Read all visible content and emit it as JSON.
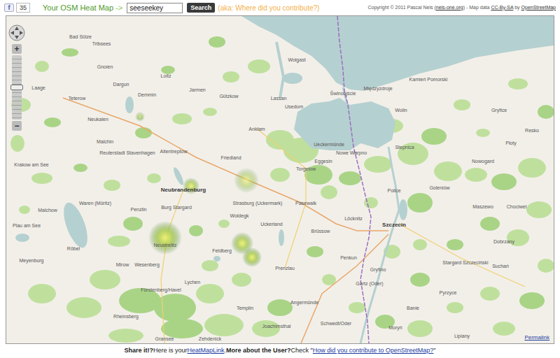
{
  "toolbar": {
    "share": {
      "icon": "f",
      "count": "35"
    },
    "title": "Your OSM Heat Map",
    "arrow": " ->",
    "search": {
      "value": "seeseekey",
      "button": "Search"
    },
    "aka": "(aka: Where did you contribute?)",
    "copyright": [
      {
        "text": "Copyright © 2011 Pascal Neis (",
        "kind": "plain"
      },
      {
        "text": "neis-one.org",
        "kind": "link"
      },
      {
        "text": ") - Map data ",
        "kind": "plain"
      },
      {
        "text": "CC-By-SA",
        "kind": "link"
      },
      {
        "text": " by ",
        "kind": "plain"
      },
      {
        "text": "OpenStreetMap",
        "kind": "link"
      }
    ]
  },
  "map": {
    "zoom": {
      "in": "+",
      "out": "−",
      "level": 0.5
    },
    "places": [
      {
        "name": "Ueckermünde",
        "kind": "town"
      },
      {
        "name": "Świnoujście",
        "kind": "town"
      },
      {
        "name": "Międzyzdroje",
        "kind": "town"
      },
      {
        "name": "Wolin",
        "kind": "town"
      },
      {
        "name": "Kamień Pomorski",
        "kind": "town"
      },
      {
        "name": "Gryfice",
        "kind": "town"
      },
      {
        "name": "Płoty",
        "kind": "town"
      },
      {
        "name": "Resko",
        "kind": "town"
      },
      {
        "name": "Nowogard",
        "kind": "town"
      },
      {
        "name": "Goleniów",
        "kind": "town"
      },
      {
        "name": "Stepnica",
        "kind": "town"
      },
      {
        "name": "Nowe Warpno",
        "kind": "town"
      },
      {
        "name": "Police",
        "kind": "town"
      },
      {
        "name": "Szczecin",
        "kind": "city"
      },
      {
        "name": "Stargard Szczeciński",
        "kind": "town"
      },
      {
        "name": "Gryfino",
        "kind": "town"
      },
      {
        "name": "Pyrzyce",
        "kind": "town"
      },
      {
        "name": "Lipiany",
        "kind": "town"
      },
      {
        "name": "Dobrzany",
        "kind": "town"
      },
      {
        "name": "Maszewo",
        "kind": "town"
      },
      {
        "name": "Chociwel",
        "kind": "town"
      },
      {
        "name": "Suchań",
        "kind": "town"
      },
      {
        "name": "Banie",
        "kind": "town"
      },
      {
        "name": "Moryń",
        "kind": "town"
      },
      {
        "name": "Schwedt/Oder",
        "kind": "town"
      },
      {
        "name": "Gartz (Oder)",
        "kind": "town"
      },
      {
        "name": "Penkun",
        "kind": "town"
      },
      {
        "name": "Löcknitz",
        "kind": "town"
      },
      {
        "name": "Brüssow",
        "kind": "town"
      },
      {
        "name": "Pasewalk",
        "kind": "town"
      },
      {
        "name": "Torgelow",
        "kind": "town"
      },
      {
        "name": "Eggesin",
        "kind": "town"
      },
      {
        "name": "Strasburg (Uckermark)",
        "kind": "town"
      },
      {
        "name": "Woldegk",
        "kind": "town"
      },
      {
        "name": "Uckerland",
        "kind": "town"
      },
      {
        "name": "Prenzlau",
        "kind": "town"
      },
      {
        "name": "Friedland",
        "kind": "town"
      },
      {
        "name": "Anklam",
        "kind": "town"
      },
      {
        "name": "Usedom",
        "kind": "town"
      },
      {
        "name": "Lassan",
        "kind": "town"
      },
      {
        "name": "Wolgast",
        "kind": "town"
      },
      {
        "name": "Gützkow",
        "kind": "town"
      },
      {
        "name": "Loitz",
        "kind": "town"
      },
      {
        "name": "Jarmen",
        "kind": "town"
      },
      {
        "name": "Demmin",
        "kind": "town"
      },
      {
        "name": "Dargun",
        "kind": "town"
      },
      {
        "name": "Neukalen",
        "kind": "town"
      },
      {
        "name": "Malchin",
        "kind": "town"
      },
      {
        "name": "Altentreptow",
        "kind": "town"
      },
      {
        "name": "Reuterstadt Stavenhagen",
        "kind": "town"
      },
      {
        "name": "Neubrandenburg",
        "kind": "city"
      },
      {
        "name": "Burg Stargard",
        "kind": "town"
      },
      {
        "name": "Penzlin",
        "kind": "town"
      },
      {
        "name": "Neustrelitz",
        "kind": "town"
      },
      {
        "name": "Feldberg",
        "kind": "town"
      },
      {
        "name": "Mirow",
        "kind": "town"
      },
      {
        "name": "Wesenberg",
        "kind": "town"
      },
      {
        "name": "Waren (Müritz)",
        "kind": "town"
      },
      {
        "name": "Malchow",
        "kind": "town"
      },
      {
        "name": "Röbel",
        "kind": "town"
      },
      {
        "name": "Lychen",
        "kind": "town"
      },
      {
        "name": "Fürstenberg/Havel",
        "kind": "town"
      },
      {
        "name": "Templin",
        "kind": "town"
      },
      {
        "name": "Rheinsberg",
        "kind": "town"
      },
      {
        "name": "Gransee",
        "kind": "town"
      },
      {
        "name": "Zehdenick",
        "kind": "town"
      },
      {
        "name": "Teterow",
        "kind": "town"
      },
      {
        "name": "Laage",
        "kind": "town"
      },
      {
        "name": "Gnoien",
        "kind": "town"
      },
      {
        "name": "Tribsees",
        "kind": "town"
      },
      {
        "name": "Bad Sülze",
        "kind": "town"
      },
      {
        "name": "Krakow am See",
        "kind": "town"
      },
      {
        "name": "Plau am See",
        "kind": "town"
      },
      {
        "name": "Meyenburg",
        "kind": "town"
      },
      {
        "name": "Angermünde",
        "kind": "town"
      },
      {
        "name": "Joachimsthal",
        "kind": "town"
      }
    ],
    "heat_spots": [
      {
        "level": 0.4
      },
      {
        "level": 0.7
      },
      {
        "level": 0.35
      },
      {
        "level": 0.9
      },
      {
        "level": 0.8
      },
      {
        "level": 0.85
      }
    ],
    "permalink": "Permalink"
  },
  "footer": [
    {
      "text": "Share it!?",
      "kind": "bold"
    },
    {
      "text": " Here is your ",
      "kind": "plain"
    },
    {
      "text": "HeatMapLink",
      "kind": "link"
    },
    {
      "text": ". ",
      "kind": "plain"
    },
    {
      "text": "More about the User?",
      "kind": "bold"
    },
    {
      "text": " Check \"",
      "kind": "plain"
    },
    {
      "text": "How did you contribute to OpenStreetMap?",
      "kind": "link"
    },
    {
      "text": "\"",
      "kind": "plain"
    }
  ]
}
